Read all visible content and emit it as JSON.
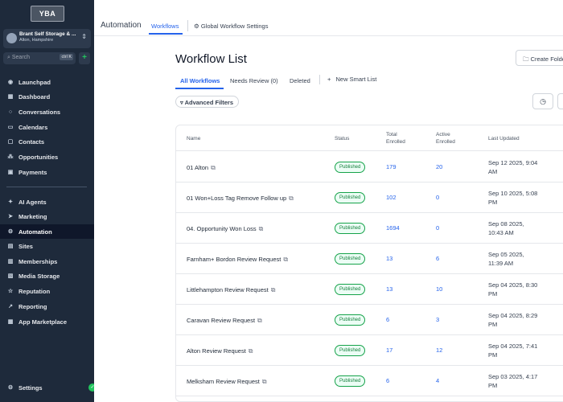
{
  "sidebar": {
    "logo_text": "YBA",
    "location": {
      "name": "Brant Self Storage & ...",
      "sub": "Alton, Hampshire"
    },
    "search": {
      "placeholder": "Search",
      "shortcut": "ctrl K"
    },
    "quick_add": "+",
    "items": [
      {
        "label": "Launchpad",
        "icon": "rocket-icon"
      },
      {
        "label": "Dashboard",
        "icon": "grid-icon"
      },
      {
        "label": "Conversations",
        "icon": "chat-icon"
      },
      {
        "label": "Calendars",
        "icon": "calendar-icon"
      },
      {
        "label": "Contacts",
        "icon": "contacts-icon"
      },
      {
        "label": "Opportunities",
        "icon": "opportunities-icon"
      },
      {
        "label": "Payments",
        "icon": "payments-icon"
      },
      {
        "label": "AI Agents",
        "icon": "ai-agents-icon"
      },
      {
        "label": "Marketing",
        "icon": "send-icon"
      },
      {
        "label": "Automation",
        "icon": "automation-icon"
      },
      {
        "label": "Sites",
        "icon": "sites-icon"
      },
      {
        "label": "Memberships",
        "icon": "memberships-icon"
      },
      {
        "label": "Media Storage",
        "icon": "media-icon"
      },
      {
        "label": "Reputation",
        "icon": "star-icon"
      },
      {
        "label": "Reporting",
        "icon": "chart-icon"
      },
      {
        "label": "App Marketplace",
        "icon": "apps-icon"
      }
    ],
    "settings": {
      "label": "Settings",
      "icon": "gear-icon"
    }
  },
  "topbar": {
    "section": "Automation",
    "tab_workflows": "Workflows",
    "tab_global": "Global Workflow Settings"
  },
  "page": {
    "title": "Workflow List",
    "create_folder": "Create Folder",
    "tabs": [
      "All Workflows",
      "Needs Review (0)",
      "Deleted"
    ],
    "new_smart_list": "New Smart List",
    "advanced_filters": "Advanced Filters"
  },
  "table": {
    "headers": {
      "name": "Name",
      "status": "Status",
      "total_enrolled": [
        "Total",
        "Enrolled"
      ],
      "active_enrolled": [
        "Active",
        "Enrolled"
      ],
      "last_updated": "Last Updated"
    },
    "rows": [
      {
        "name": "01 Alton",
        "status": "Published",
        "total": "179",
        "active": "20",
        "updated": [
          "Sep 12 2025, 9:04",
          "AM"
        ]
      },
      {
        "name": "01 Won+Loss Tag Remove Follow up",
        "status": "Published",
        "total": "102",
        "active": "0",
        "updated": [
          "Sep 10 2025, 5:08",
          "PM"
        ]
      },
      {
        "name": "04. Opportunity Won Loss",
        "status": "Published",
        "total": "1694",
        "active": "0",
        "updated": [
          "Sep 08 2025,",
          "10:43 AM"
        ]
      },
      {
        "name": "Farnham+ Bordon Review Request",
        "status": "Published",
        "total": "13",
        "active": "6",
        "updated": [
          "Sep 05 2025,",
          "11:39 AM"
        ]
      },
      {
        "name": "Littlehampton Review Request",
        "status": "Published",
        "total": "13",
        "active": "10",
        "updated": [
          "Sep 04 2025, 8:30",
          "PM"
        ]
      },
      {
        "name": "Caravan Review Request",
        "status": "Published",
        "total": "6",
        "active": "3",
        "updated": [
          "Sep 04 2025, 8:29",
          "PM"
        ]
      },
      {
        "name": "Alton Review Request",
        "status": "Published",
        "total": "17",
        "active": "12",
        "updated": [
          "Sep 04 2025, 7:41",
          "PM"
        ]
      },
      {
        "name": "Melksham Review Request",
        "status": "Published",
        "total": "6",
        "active": "4",
        "updated": [
          "Sep 03 2025, 4:17",
          "PM"
        ]
      }
    ]
  }
}
